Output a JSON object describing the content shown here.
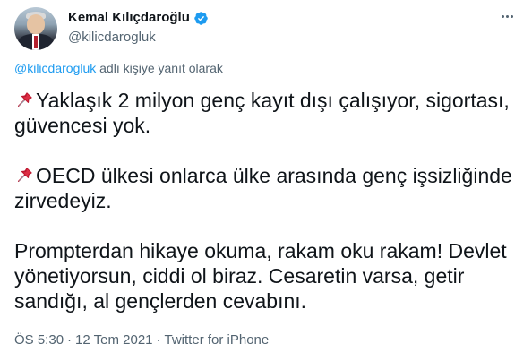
{
  "author": {
    "display_name": "Kemal Kılıçdaroğlu",
    "handle": "@kilicdarogluk",
    "verified_color": "#1d9bf0"
  },
  "reply_context": {
    "mention": "@kilicdarogluk",
    "suffix": " adlı kişiye yanıt olarak"
  },
  "tweet": {
    "line1": "Yaklaşık 2 milyon genç kayıt dışı çalışıyor, sigortası, güvencesi yok.",
    "line2": "OECD ülkesi onlarca ülke arasında genç işsizliğinde zirvedeyiz.",
    "line3": "Prompterdan hikaye okuma, rakam oku rakam! Devlet yönetiyorsun, ciddi ol biraz. Cesaretin varsa, getir sandığı, al gençlerden cevabını."
  },
  "meta": {
    "time": "ÖS 5:30",
    "separator": "·",
    "date": "12 Tem 2021",
    "source": "Twitter for iPhone"
  },
  "icons": {
    "verified": "verified-badge-icon",
    "pin": "pushpin-icon",
    "more": "more-options-icon"
  },
  "colors": {
    "text_primary": "#0f1419",
    "text_secondary": "#536471",
    "accent": "#1d9bf0",
    "pin_red": "#dd2e44"
  }
}
